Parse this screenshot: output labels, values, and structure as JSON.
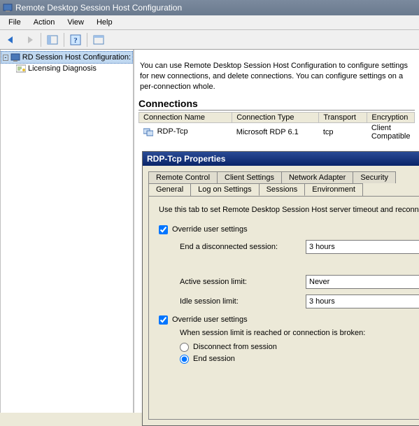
{
  "window": {
    "title": "Remote Desktop Session Host Configuration"
  },
  "menu": {
    "file": "File",
    "action": "Action",
    "view": "View",
    "help": "Help"
  },
  "tree": {
    "root": "RD Session Host Configuration:",
    "child1": "Licensing Diagnosis"
  },
  "intro": {
    "line": "You can use Remote Desktop Session Host Configuration to configure settings for new connections, and delete connections. You can configure settings on a per-connection whole."
  },
  "connections": {
    "heading": "Connections",
    "columns": {
      "name": "Connection Name",
      "type": "Connection Type",
      "transport": "Transport",
      "encryption": "Encryption"
    },
    "rows": [
      {
        "name": "RDP-Tcp",
        "type": "Microsoft RDP 6.1",
        "transport": "tcp",
        "encryption": "Client Compatible"
      }
    ]
  },
  "dialog": {
    "title": "RDP-Tcp Properties",
    "tabs_row1": {
      "remote_control": "Remote Control",
      "client_settings": "Client Settings",
      "network_adapter": "Network Adapter",
      "security": "Security"
    },
    "tabs_row2": {
      "general": "General",
      "log_on": "Log on Settings",
      "sessions": "Sessions",
      "environment": "Environment"
    },
    "sessions": {
      "desc": "Use this tab to set Remote Desktop Session Host server timeout and reconnection settings.",
      "override1": "Override user settings",
      "end_disconnected_label": "End a disconnected session:",
      "end_disconnected_value": "3 hours",
      "active_limit_label": "Active session limit:",
      "active_limit_value": "Never",
      "idle_limit_label": "Idle session limit:",
      "idle_limit_value": "3 hours",
      "override2": "Override user settings",
      "when_reached": "When session limit is reached or connection is broken:",
      "radio_disconnect": "Disconnect from session",
      "radio_end": "End session"
    }
  }
}
